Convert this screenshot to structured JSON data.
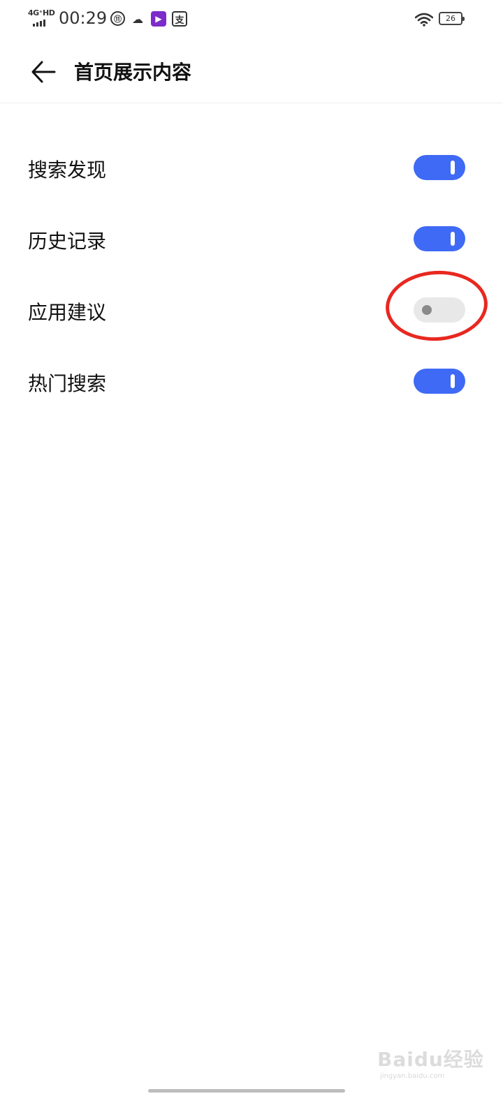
{
  "status_bar": {
    "network_label": "4G⁺HD",
    "time": "00:29",
    "icons": [
      "data-saver-icon",
      "cloud-icon",
      "video-app-icon",
      "pay-app-icon",
      "wifi-icon",
      "battery-icon"
    ],
    "data_saver_glyph": "⑪",
    "cloud_glyph": "☁",
    "video_glyph": "▶",
    "pay_glyph": "支",
    "battery_level": "26"
  },
  "app_bar": {
    "back_icon": "back-arrow-icon",
    "title": "首页展示内容"
  },
  "settings": [
    {
      "label": "搜索发现",
      "enabled": true
    },
    {
      "label": "历史记录",
      "enabled": true
    },
    {
      "label": "应用建议",
      "enabled": false
    },
    {
      "label": "热门搜索",
      "enabled": true
    }
  ],
  "annotation": {
    "highlight_color": "#e82820"
  },
  "watermark": {
    "brand": "Baidu经验",
    "url": "jingyan.baidu.com"
  },
  "colors": {
    "toggle_on": "#3f6af5",
    "toggle_off": "#e8e8e8"
  }
}
